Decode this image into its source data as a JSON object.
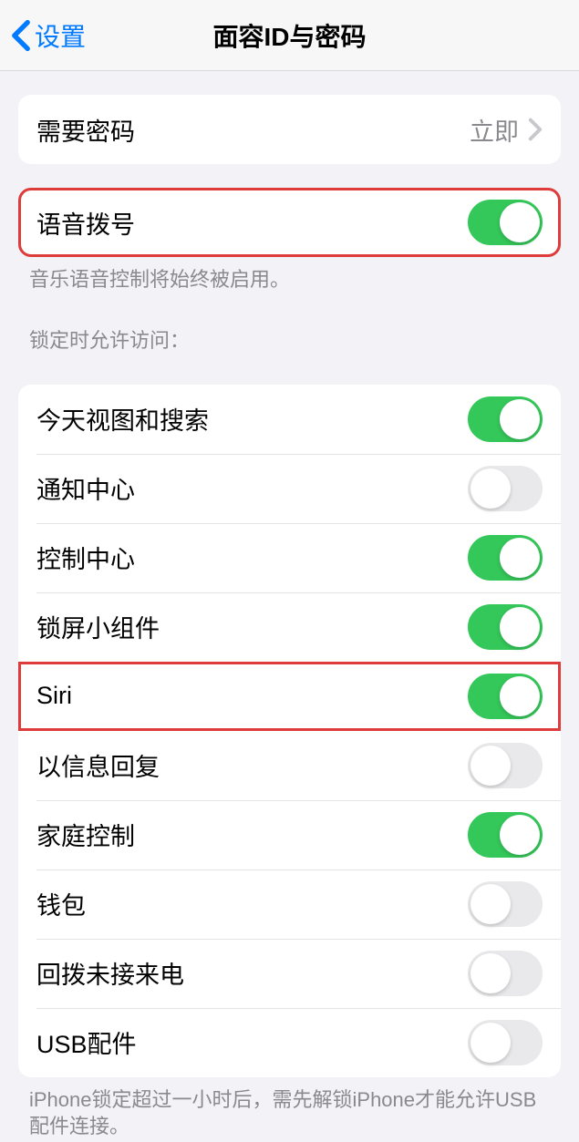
{
  "nav": {
    "back_label": "设置",
    "title": "面容ID与密码"
  },
  "group_passcode": {
    "require_passcode_label": "需要密码",
    "require_passcode_value": "立即"
  },
  "group_voice_dial": {
    "voice_dial_label": "语音拨号",
    "voice_dial_on": true,
    "footer": "音乐语音控制将始终被启用。"
  },
  "group_locked_access": {
    "header": "锁定时允许访问：",
    "items": [
      {
        "label": "今天视图和搜索",
        "on": true,
        "highlight": false
      },
      {
        "label": "通知中心",
        "on": false,
        "highlight": false
      },
      {
        "label": "控制中心",
        "on": true,
        "highlight": false
      },
      {
        "label": "锁屏小组件",
        "on": true,
        "highlight": false
      },
      {
        "label": "Siri",
        "on": true,
        "highlight": true
      },
      {
        "label": "以信息回复",
        "on": false,
        "highlight": false
      },
      {
        "label": "家庭控制",
        "on": true,
        "highlight": false
      },
      {
        "label": "钱包",
        "on": false,
        "highlight": false
      },
      {
        "label": "回拨未接来电",
        "on": false,
        "highlight": false
      },
      {
        "label": "USB配件",
        "on": false,
        "highlight": false
      }
    ],
    "footer": "iPhone锁定超过一小时后，需先解锁iPhone才能允许USB配件连接。"
  }
}
